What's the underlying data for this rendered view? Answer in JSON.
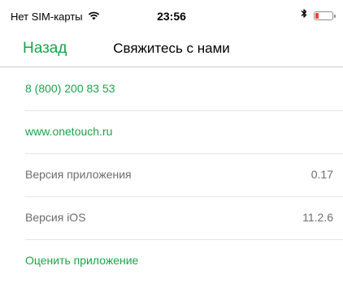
{
  "status_bar": {
    "carrier": "Нет SIM-карты",
    "time": "23:56",
    "wifi_icon": "wifi-icon",
    "bluetooth_icon": "bluetooth-icon",
    "battery_level": 0.2,
    "battery_color": "#ff3b30"
  },
  "nav": {
    "back_label": "Назад",
    "title": "Свяжитесь с нами"
  },
  "rows": [
    {
      "label": "8 (800) 200 83 53",
      "value": ""
    },
    {
      "label": "www.onetouch.ru",
      "value": ""
    },
    {
      "label": "Версия приложения",
      "value": "0.17"
    },
    {
      "label": "Версия iOS",
      "value": "11.2.6"
    },
    {
      "label": "Оценить приложение",
      "value": ""
    }
  ],
  "colors": {
    "accent": "#1aa54a",
    "secondary_text": "#6d6d72"
  }
}
